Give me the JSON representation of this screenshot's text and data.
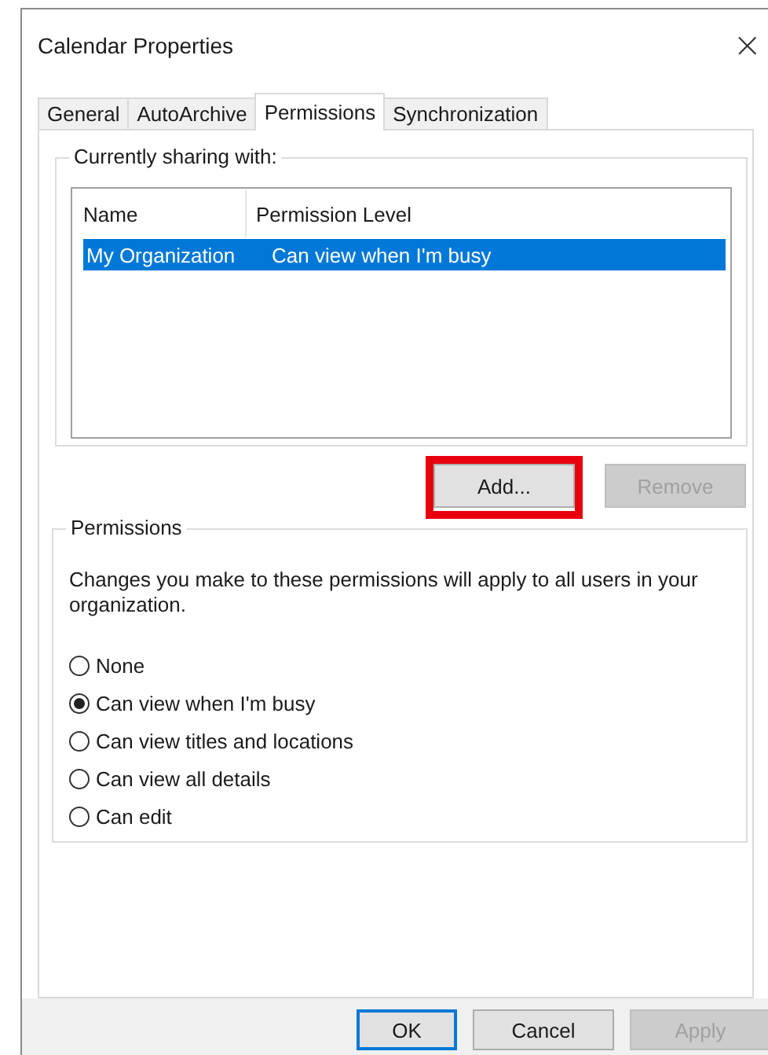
{
  "window": {
    "title": "Calendar Properties",
    "close": "×"
  },
  "tabs": [
    {
      "label": "General",
      "selected": false
    },
    {
      "label": "AutoArchive",
      "selected": false
    },
    {
      "label": "Permissions",
      "selected": true
    },
    {
      "label": "Synchronization",
      "selected": false
    }
  ],
  "sharing": {
    "legend": "Currently sharing with:",
    "columns": [
      "Name",
      "Permission Level"
    ],
    "rows": [
      {
        "cells": [
          "My Organization",
          "Can view when I'm busy"
        ],
        "selected": true
      }
    ]
  },
  "list_buttons": [
    {
      "label": "Add...",
      "disabled": false,
      "highlighted": true
    },
    {
      "label": "Remove",
      "disabled": true,
      "highlighted": false
    }
  ],
  "permissions": {
    "legend": "Permissions",
    "description": "Changes you make to these permissions will apply to all users in your organization.",
    "options": [
      {
        "label": "None",
        "selected": false
      },
      {
        "label": "Can view when I'm busy",
        "selected": true
      },
      {
        "label": "Can view titles and locations",
        "selected": false
      },
      {
        "label": "Can view all details",
        "selected": false
      },
      {
        "label": "Can edit",
        "selected": false
      }
    ]
  },
  "buttons": [
    {
      "label": "OK",
      "disabled": false,
      "default": true
    },
    {
      "label": "Cancel",
      "disabled": false,
      "default": false
    },
    {
      "label": "Apply",
      "disabled": true,
      "default": false
    }
  ]
}
